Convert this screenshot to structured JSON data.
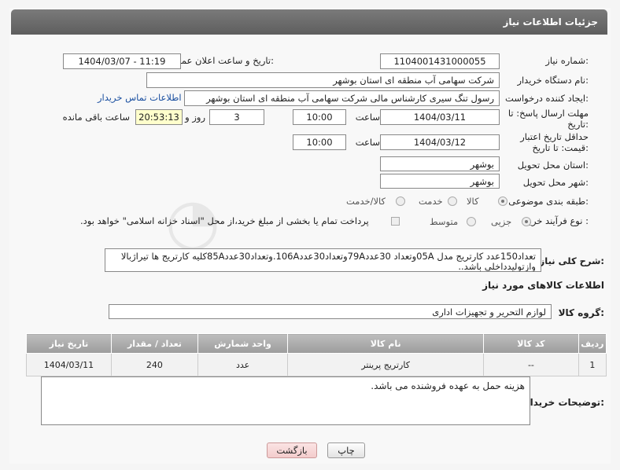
{
  "header": {
    "title": "جزئیات اطلاعات نیاز"
  },
  "fields": {
    "need_number_label": "شماره نیاز:",
    "need_number": "1104001431000055",
    "announce_label": "تاریخ و ساعت اعلان عمومی:",
    "announce_value": "1404/03/07 - 11:19",
    "buyer_label": "نام دستگاه خریدار:",
    "buyer_value": "شرکت سهامی آب منطقه ای استان بوشهر",
    "creator_label": "ایجاد کننده درخواست:",
    "creator_value": "رسول تنگ سیری کارشناس مالی شرکت سهامی آب منطقه ای استان بوشهر",
    "contact_link": "اطلاعات تماس خریدار",
    "deadline_label": "مهلت ارسال پاسخ: تا تاریخ:",
    "deadline_date": "1404/03/11",
    "time_label": "ساعت",
    "deadline_time": "10:00",
    "days_value": "3",
    "days_label": "روز و",
    "remaining_value": "20:53:13",
    "remaining_label": "ساعت باقی مانده",
    "validity_label": "حداقل تاریخ اعتبار قیمت: تا تاریخ:",
    "validity_date": "1404/03/12",
    "validity_time": "10:00",
    "province_label": "استان محل تحویل:",
    "province_value": "بوشهر",
    "city_label": "شهر محل تحویل:",
    "city_value": "بوشهر",
    "category_label": "طبقه بندی موضوعی:",
    "category_options": [
      "کالا",
      "خدمت",
      "کالا/خدمت"
    ],
    "process_label": "نوع فرآیند خرید :",
    "process_options": [
      "جزیی",
      "متوسط"
    ],
    "payment_note": "پرداخت تمام یا بخشی از مبلغ خرید،از محل \"اسناد خزانه اسلامی\" خواهد بود."
  },
  "description": {
    "label": "شرح کلی نیاز:",
    "text": "تعداد150عدد کارتریج مدل 05Aوتعداد 30عدد79Aوتعداد30عدد106A.وتعداد30عدد85Aکلیه کارتریج ها تیراژبالا وازتولیدداخلی باشد.."
  },
  "goods": {
    "section_title": "اطلاعات کالاهای مورد نیاز",
    "group_label": "گروه کالا:",
    "group_value": "لوازم التحریر و تجهیزات اداری",
    "columns": [
      "ردیف",
      "کد کالا",
      "نام کالا",
      "واحد شمارش",
      "تعداد / مقدار",
      "تاریخ نیاز"
    ],
    "rows": [
      {
        "row": "1",
        "code": "--",
        "name": "کارتریج پرینتر",
        "unit": "عدد",
        "qty": "240",
        "date": "1404/03/11"
      }
    ]
  },
  "buyer_notes": {
    "label": "توضیحات خریدار:",
    "text": "هزینه حمل به عهده فروشنده می باشد."
  },
  "buttons": {
    "print": "چاپ",
    "back": "بازگشت"
  },
  "colors": {
    "header": "#6b6b6b",
    "link": "#1a4fa0",
    "highlight": "#ffffcc"
  }
}
